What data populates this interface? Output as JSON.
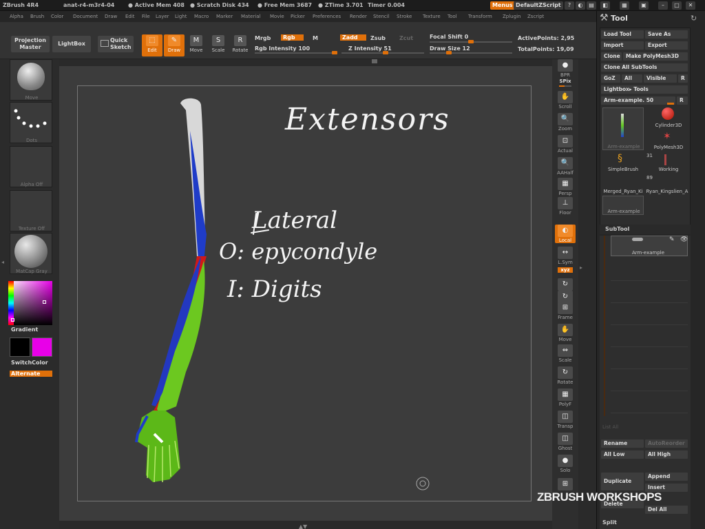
{
  "titlebar": {
    "app": "ZBrush 4R4",
    "doc": "anat-r4-m3r4-04",
    "active_mem": "● Active Mem 408",
    "scratch": "● Scratch Disk 434",
    "free_mem": "● Free Mem 3687",
    "ztime": "● ZTime 3.701",
    "timer": "Timer 0.004",
    "menus_btn": "Menus",
    "script_btn": "DefaultZScript"
  },
  "menubar": [
    "Alpha",
    "Brush",
    "Color",
    "Document",
    "Draw",
    "Edit",
    "File",
    "Layer",
    "Light",
    "Macro",
    "Marker",
    "Material",
    "Movie",
    "Picker",
    "Preferences",
    "Render",
    "Stencil",
    "Stroke",
    "Texture",
    "Tool",
    "Transform",
    "Zplugin",
    "Zscript"
  ],
  "shelf": {
    "projection_master": "Projection Master",
    "lightbox": "LightBox",
    "quick_sketch": "Quick Sketch",
    "edit": "Edit",
    "draw": "Draw",
    "move": "Move",
    "scale": "Scale",
    "rotate": "Rotate",
    "mrgb": "Mrgb",
    "rgb": "Rgb",
    "m": "M",
    "rgb_intensity": "Rgb Intensity 100",
    "zadd": "Zadd",
    "zsub": "Zsub",
    "zcut": "Zcut",
    "z_intensity": "Z Intensity 51",
    "focal_shift": "Focal Shift 0",
    "draw_size": "Draw Size 12",
    "active_points": "ActivePoints: 2,95",
    "total_points": "TotalPoints: 19,09",
    "rgb_intensity_value": 100,
    "z_intensity_value": 51,
    "focal_shift_value": 0,
    "draw_size_value": 12
  },
  "lefttray": {
    "move": "Move",
    "dots": "Dots",
    "alpha_off": "Alpha Off",
    "texture_off": "Texture Off",
    "matcap_gray": "MatCap Gray",
    "gradient": "Gradient",
    "switch_color": "SwitchColor",
    "alternate": "Alternate"
  },
  "canvas": {
    "title": "Extensors",
    "line1": "Lateral",
    "line2": "O: epycondyle",
    "line3": "I: Digits"
  },
  "rightshelf": [
    "BPR",
    "SPix",
    "Scroll",
    "Zoom",
    "Actual",
    "AAHalf",
    "Persp",
    "Floor",
    "Local",
    "L.Sym",
    "xyz",
    "",
    "",
    "Frame",
    "Move",
    "Scale",
    "Rotate",
    "PolyF",
    "Transp",
    "Ghost",
    "Solo",
    ""
  ],
  "rightpanel": {
    "title": "Tool",
    "load_tool": "Load Tool",
    "save_as": "Save As",
    "import": "Import",
    "export": "Export",
    "clone": "Clone",
    "make_polymesh": "Make PolyMesh3D",
    "clone_all": "Clone All SubTools",
    "goz": "GoZ",
    "all": "All",
    "visible": "Visible",
    "r": "R",
    "lightbox_tools": "Lightbox▸ Tools",
    "arm_example": "Arm-example. 50",
    "tiles": [
      "Arm-example",
      "Cylinder3D",
      "PolyMesh3D",
      "SimpleBrush",
      "Working",
      "Merged_Ryan_Ki",
      "Ryan_Kingslien_A",
      "Arm-example"
    ],
    "tile_counts": [
      "31",
      "89"
    ],
    "subtool": "SubTool",
    "subtool_item": "Arm-example",
    "list_all": "List All",
    "rename": "Rename",
    "autoreorder": "AutoReorder",
    "all_low": "All Low",
    "all_high": "All High",
    "duplicate": "Duplicate",
    "append": "Append",
    "insert": "Insert",
    "delete": "Delete",
    "del_all": "Del All",
    "split": "Split"
  },
  "watermark": "ZBRUSH WORKSHOPS",
  "colors": {
    "accent": "#e0700a",
    "secondary": "#e800e8",
    "primary": "#000000"
  }
}
